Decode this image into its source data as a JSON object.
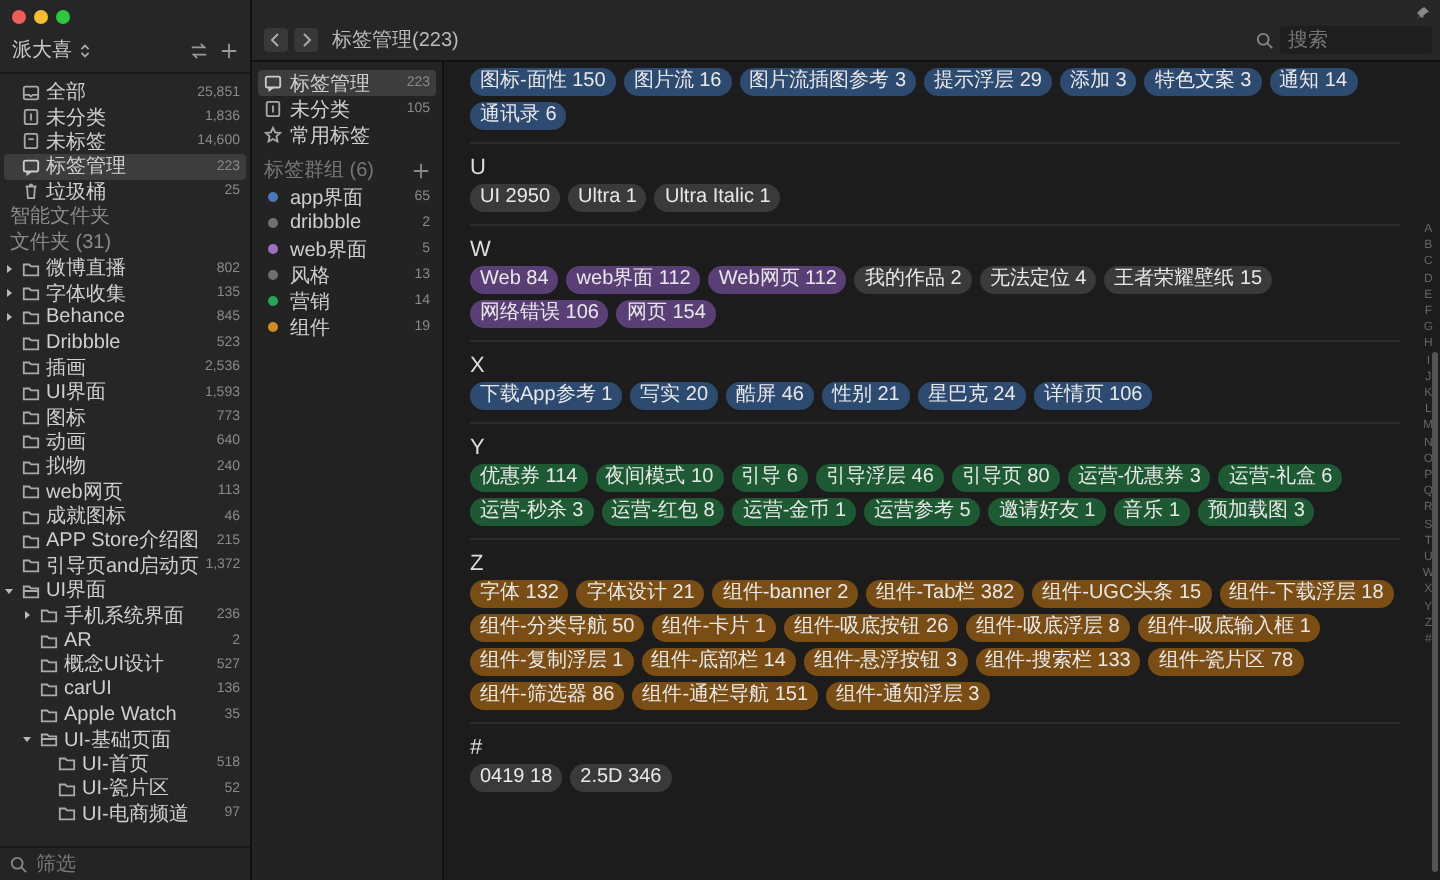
{
  "library": {
    "name": "派大喜"
  },
  "sidebar": {
    "items": [
      {
        "name": "全部",
        "count": "25,851",
        "kind": "all",
        "selected": false
      },
      {
        "name": "未分类",
        "count": "1,836",
        "kind": "uncategorized",
        "selected": false
      },
      {
        "name": "未标签",
        "count": "14,600",
        "kind": "untagged",
        "selected": false
      },
      {
        "name": "标签管理",
        "count": "223",
        "kind": "tags",
        "selected": true
      },
      {
        "name": "垃圾桶",
        "count": "25",
        "kind": "trash",
        "selected": false
      }
    ],
    "smart_folders_label": "智能文件夹",
    "folders_label": "文件夹 (31)",
    "folders": [
      {
        "name": "微博直播",
        "count": "802",
        "has_children": true,
        "expanded": false,
        "selected": false
      },
      {
        "name": "字体收集",
        "count": "135",
        "has_children": true,
        "expanded": false,
        "selected": false
      },
      {
        "name": "Behance",
        "count": "845",
        "has_children": true,
        "expanded": false,
        "selected": false
      },
      {
        "name": "Dribbble",
        "count": "523",
        "has_children": false,
        "expanded": false,
        "selected": false
      },
      {
        "name": "插画",
        "count": "2,536",
        "has_children": false,
        "expanded": false,
        "selected": false
      },
      {
        "name": "UI界面",
        "count": "1,593",
        "has_children": false,
        "expanded": false,
        "selected": false
      },
      {
        "name": "图标",
        "count": "773",
        "has_children": false,
        "expanded": false,
        "selected": false
      },
      {
        "name": "动画",
        "count": "640",
        "has_children": false,
        "expanded": false,
        "selected": false
      },
      {
        "name": "拟物",
        "count": "240",
        "has_children": false,
        "expanded": false,
        "selected": false
      },
      {
        "name": "web网页",
        "count": "113",
        "has_children": false,
        "expanded": false,
        "selected": false
      },
      {
        "name": "成就图标",
        "count": "46",
        "has_children": false,
        "expanded": false,
        "selected": false
      },
      {
        "name": "APP Store介绍图",
        "count": "215",
        "has_children": false,
        "expanded": false,
        "selected": false
      },
      {
        "name": "引导页and启动页",
        "count": "1,372",
        "has_children": false,
        "expanded": false,
        "selected": false
      },
      {
        "name": "UI界面",
        "has_children": true,
        "expanded": true,
        "selected": false,
        "children": [
          {
            "name": "手机系统界面",
            "count": "236",
            "has_children": true,
            "expanded": false,
            "selected": false
          },
          {
            "name": "AR",
            "count": "2",
            "has_children": false,
            "expanded": false,
            "selected": false
          },
          {
            "name": "概念UI设计",
            "count": "527",
            "has_children": false,
            "expanded": false,
            "selected": false
          },
          {
            "name": "carUI",
            "count": "136",
            "has_children": false,
            "expanded": false,
            "selected": false
          },
          {
            "name": "Apple Watch",
            "count": "35",
            "has_children": false,
            "expanded": false,
            "selected": false
          },
          {
            "name": "UI-基础页面",
            "has_children": true,
            "expanded": true,
            "selected": false,
            "children": [
              {
                "name": "UI-首页",
                "count": "518",
                "has_children": false,
                "expanded": false,
                "selected": false
              },
              {
                "name": "UI-瓷片区",
                "count": "52",
                "has_children": false,
                "expanded": false,
                "selected": false
              },
              {
                "name": "UI-电商频道",
                "count": "97",
                "has_children": false,
                "expanded": false,
                "selected": false
              }
            ]
          }
        ]
      }
    ],
    "filter": {
      "placeholder": "筛选"
    }
  },
  "nav": {
    "title": "标签管理(223)"
  },
  "tag_panel": {
    "items": [
      {
        "name": "标签管理",
        "count": "223",
        "kind": "tags",
        "selected": true
      },
      {
        "name": "未分类",
        "count": "105",
        "kind": "uncategorized",
        "selected": false
      },
      {
        "name": "常用标签",
        "kind": "star",
        "selected": false
      }
    ],
    "groups_label": "标签群组 (6)",
    "groups": [
      {
        "name": "app界面",
        "count": "65",
        "color": "#4a78b8"
      },
      {
        "name": "dribbble",
        "count": "2",
        "color": "#707070"
      },
      {
        "name": "web界面",
        "count": "5",
        "color": "#9a70c4"
      },
      {
        "name": "风格",
        "count": "13",
        "color": "#707070"
      },
      {
        "name": "营销",
        "count": "14",
        "color": "#25a55a"
      },
      {
        "name": "组件",
        "count": "19",
        "color": "#d68a22"
      }
    ]
  },
  "search": {
    "placeholder": "搜索"
  },
  "sections": [
    {
      "tags": [
        {
          "text": "图标-面性 150",
          "color": "#2d4a70"
        },
        {
          "text": "图片流 16",
          "color": "#2d4a70"
        },
        {
          "text": "图片流插图参考 3",
          "color": "#2d4a70"
        },
        {
          "text": "提示浮层 29",
          "color": "#2d4a70"
        },
        {
          "text": "添加 3",
          "color": "#2d4a70"
        },
        {
          "text": "特色文案 3",
          "color": "#2d4a70"
        },
        {
          "text": "通知 14",
          "color": "#2d4a70"
        },
        {
          "text": "通讯录 6",
          "color": "#2d4a70"
        }
      ]
    },
    {
      "heading": "U",
      "tags": [
        {
          "text": "UI 2950",
          "color": "#3a3a3a"
        },
        {
          "text": "Ultra 1",
          "color": "#3a3a3a"
        },
        {
          "text": "Ultra Italic 1",
          "color": "#3a3a3a"
        }
      ]
    },
    {
      "heading": "W",
      "tags": [
        {
          "text": "Web 84",
          "color": "#5a3f76"
        },
        {
          "text": "web界面 112",
          "color": "#5a3f76"
        },
        {
          "text": "Web网页 112",
          "color": "#5a3f76"
        },
        {
          "text": "我的作品 2",
          "color": "#3a3a3a"
        },
        {
          "text": "无法定位 4",
          "color": "#3a3a3a"
        },
        {
          "text": "王者荣耀壁纸 15",
          "color": "#3a3a3a"
        },
        {
          "text": "网络错误 106",
          "color": "#5a3f76"
        },
        {
          "text": "网页 154",
          "color": "#5a3f76"
        }
      ]
    },
    {
      "heading": "X",
      "tags": [
        {
          "text": "下载App参考 1",
          "color": "#2d4a70"
        },
        {
          "text": "写实 20",
          "color": "#2d4a70"
        },
        {
          "text": "酷屏 46",
          "color": "#2d4a70"
        },
        {
          "text": "性别 21",
          "color": "#2d4a70"
        },
        {
          "text": "星巴克 24",
          "color": "#2d4a70"
        },
        {
          "text": "详情页 106",
          "color": "#2d4a70"
        }
      ]
    },
    {
      "heading": "Y",
      "tags": [
        {
          "text": "优惠券 114",
          "color": "#1d5a33"
        },
        {
          "text": "夜间模式 10",
          "color": "#1d5a33"
        },
        {
          "text": "引导 6",
          "color": "#1d5a33"
        },
        {
          "text": "引导浮层 46",
          "color": "#1d5a33"
        },
        {
          "text": "引导页 80",
          "color": "#1d5a33"
        },
        {
          "text": "运营-优惠券 3",
          "color": "#1d5a33"
        },
        {
          "text": "运营-礼盒 6",
          "color": "#1d5a33"
        },
        {
          "text": "运营-秒杀 3",
          "color": "#1d5a33"
        },
        {
          "text": "运营-红包 8",
          "color": "#1d5a33"
        },
        {
          "text": "运营-金币 1",
          "color": "#1d5a33"
        },
        {
          "text": "运营参考 5",
          "color": "#1d5a33"
        },
        {
          "text": "邀请好友 1",
          "color": "#1d5a33"
        },
        {
          "text": "音乐 1",
          "color": "#1d5a33"
        },
        {
          "text": "预加载图 3",
          "color": "#1d5a33"
        }
      ]
    },
    {
      "heading": "Z",
      "tags": [
        {
          "text": "字体 132",
          "color": "#794d14"
        },
        {
          "text": "字体设计 21",
          "color": "#794d14"
        },
        {
          "text": "组件-banner 2",
          "color": "#794d14"
        },
        {
          "text": "组件-Tab栏 382",
          "color": "#794d14"
        },
        {
          "text": "组件-UGC头条 15",
          "color": "#794d14"
        },
        {
          "text": "组件-下载浮层 18",
          "color": "#794d14"
        },
        {
          "text": "组件-分类导航 50",
          "color": "#794d14"
        },
        {
          "text": "组件-卡片 1",
          "color": "#794d14"
        },
        {
          "text": "组件-吸底按钮 26",
          "color": "#794d14"
        },
        {
          "text": "组件-吸底浮层 8",
          "color": "#794d14"
        },
        {
          "text": "组件-吸底输入框 1",
          "color": "#794d14"
        },
        {
          "text": "组件-复制浮层 1",
          "color": "#794d14"
        },
        {
          "text": "组件-底部栏 14",
          "color": "#794d14"
        },
        {
          "text": "组件-悬浮按钮 3",
          "color": "#794d14"
        },
        {
          "text": "组件-搜索栏 133",
          "color": "#794d14"
        },
        {
          "text": "组件-瓷片区 78",
          "color": "#794d14"
        },
        {
          "text": "组件-筛选器 86",
          "color": "#794d14"
        },
        {
          "text": "组件-通栏导航 151",
          "color": "#794d14"
        },
        {
          "text": "组件-通知浮层 3",
          "color": "#794d14"
        }
      ]
    },
    {
      "heading": "#",
      "tags": [
        {
          "text": "0419 18",
          "color": "#3a3a3a"
        },
        {
          "text": "2.5D 346",
          "color": "#3a3a3a"
        }
      ]
    }
  ],
  "index_letters": [
    "A",
    "B",
    "C",
    "D",
    "E",
    "F",
    "G",
    "H",
    "I",
    "J",
    "K",
    "L",
    "M",
    "N",
    "O",
    "P",
    "Q",
    "R",
    "S",
    "T",
    "U",
    "W",
    "X",
    "Y",
    "Z",
    "#"
  ]
}
